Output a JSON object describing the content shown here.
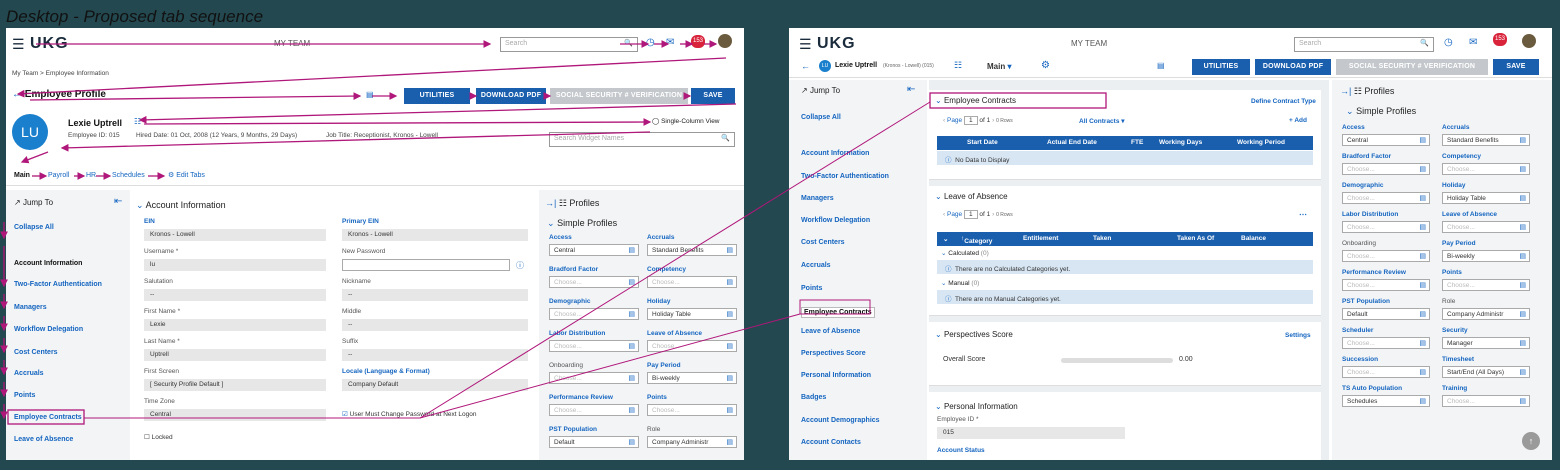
{
  "slide_title": "Desktop - Proposed tab sequence",
  "app": {
    "logo": "UKG",
    "title": "MY TEAM",
    "search_placeholder": "Search",
    "notification_count": "153"
  },
  "left": {
    "breadcrumb": "My Team > Employee Information",
    "page_title": "Employee Profile",
    "buttons": {
      "utilities": "UTILITIES",
      "download_pdf": "DOWNLOAD PDF",
      "ssn": "SOCIAL SECURITY # VERIFICATION",
      "save": "SAVE"
    },
    "employee": {
      "initials": "LU",
      "name": "Lexie Uptrell",
      "id_line": "Employee ID: 015",
      "hired": "Hired Date: 01 Oct, 2008 (12 Years, 9 Months, 29 Days)",
      "job": "Job Title: Receptionist, Kronos - Lowell"
    },
    "single_column": "Single-Column View",
    "widget_search": "Search Widget Names",
    "tabs": [
      "Main",
      "Payroll",
      "HR",
      "Schedules",
      "Edit Tabs"
    ],
    "jump_to": "Jump To",
    "sidebar": [
      "Collapse All",
      "Account Information",
      "Two-Factor Authentication",
      "Managers",
      "Workflow Delegation",
      "Cost Centers",
      "Accruals",
      "Points",
      "Employee Contracts",
      "Leave of Absence"
    ],
    "account": {
      "title": "Account Information",
      "fields": [
        {
          "label": "EIN",
          "value": "Kronos - Lowell",
          "label2": "Primary EIN",
          "value2": "Kronos - Lowell"
        },
        {
          "label": "Username *",
          "value": "lu",
          "label2": "New Password",
          "value2": ""
        },
        {
          "label": "Salutation",
          "value": "--",
          "label2": "Nickname",
          "value2": "--"
        },
        {
          "label": "First Name *",
          "value": "Lexie",
          "label2": "Middle",
          "value2": "--"
        },
        {
          "label": "Last Name *",
          "value": "Uptrell",
          "label2": "Suffix",
          "value2": "--"
        },
        {
          "label": "First Screen",
          "value": "[ Security Profile Default ]",
          "label2": "Locale (Language & Format)",
          "value2": "Company Default"
        },
        {
          "label": "Time Zone",
          "value": "Central",
          "label2": "",
          "value2": ""
        }
      ],
      "must_change": "User Must Change Password at Next Logon",
      "locked": "Locked"
    },
    "profiles_title": "Profiles",
    "simple_profiles": "Simple Profiles",
    "profiles": [
      {
        "label": "Access",
        "value": "Central",
        "label2": "Accruals",
        "value2": "Standard Benefits"
      },
      {
        "label": "Bradford Factor",
        "value": "Choose...",
        "label2": "Competency",
        "value2": "Choose..."
      },
      {
        "label": "Demographic",
        "value": "Choose...",
        "label2": "Holiday",
        "value2": "Holiday Table"
      },
      {
        "label": "Labor Distribution",
        "value": "Choose...",
        "label2": "Leave of Absence",
        "value2": "Choose..."
      },
      {
        "label": "Onboarding",
        "value": "Choose...",
        "label2": "Pay Period",
        "value2": "Bi-weekly"
      },
      {
        "label": "Performance Review",
        "value": "Choose...",
        "label2": "Points",
        "value2": "Choose..."
      },
      {
        "label": "PST Population",
        "value": "Default",
        "label2": "Role",
        "value2": "Company Administr"
      }
    ]
  },
  "right": {
    "employee_chip": "Lexie Uptrell",
    "employee_chip_sub": "(Kronos - Lowell) (015)",
    "chip_initials": "LU",
    "tab_main": "Main",
    "buttons": {
      "utilities": "UTILITIES",
      "download_pdf": "DOWNLOAD PDF",
      "ssn": "SOCIAL SECURITY # VERIFICATION",
      "save": "SAVE"
    },
    "jump_to": "Jump To",
    "sidebar": [
      "Collapse All",
      "Account Information",
      "Two-Factor Authentication",
      "Managers",
      "Workflow Delegation",
      "Cost Centers",
      "Accruals",
      "Points",
      "Employee Contracts",
      "Leave of Absence",
      "Perspectives Score",
      "Personal Information",
      "Badges",
      "Account Demographics",
      "Account Contacts",
      "Pay Information"
    ],
    "contracts": {
      "title": "Employee Contracts",
      "define": "Define Contract Type",
      "page": "Page",
      "page_num": "1",
      "of": "of 1",
      "rows": "0 Rows",
      "all": "All Contracts",
      "add": "+ Add",
      "cols": [
        "Start Date",
        "Actual End Date",
        "FTE",
        "Working Days",
        "Working Period"
      ],
      "empty": "No Data to Display"
    },
    "loa": {
      "title": "Leave of Absence",
      "page": "Page",
      "page_num": "1",
      "of": "of 1",
      "rows": "0 Rows",
      "cols": [
        "Category",
        "Entitlement",
        "Taken",
        "Taken As Of",
        "Balance"
      ],
      "calc": "Calculated",
      "calc_count": "(0)",
      "calc_note": "There are no Calculated Categories yet.",
      "manual": "Manual",
      "manual_count": "(0)",
      "manual_note": "There are no Manual Categories yet."
    },
    "perspectives": {
      "title": "Perspectives Score",
      "settings": "Settings",
      "overall": "Overall Score",
      "score": "0.00"
    },
    "personal": {
      "title": "Personal Information",
      "emp_id_label": "Employee ID *",
      "emp_id": "015",
      "status": "Account Status"
    },
    "profiles_title": "Profiles",
    "simple_profiles": "Simple Profiles",
    "profiles": [
      {
        "label": "Access",
        "value": "Central",
        "label2": "Accruals",
        "value2": "Standard Benefits"
      },
      {
        "label": "Bradford Factor",
        "value": "Choose...",
        "label2": "Competency",
        "value2": "Choose..."
      },
      {
        "label": "Demographic",
        "value": "Choose...",
        "label2": "Holiday",
        "value2": "Holiday Table"
      },
      {
        "label": "Labor Distribution",
        "value": "Choose...",
        "label2": "Leave of Absence",
        "value2": "Choose..."
      },
      {
        "label": "Onboarding",
        "value": "Choose...",
        "label2": "Pay Period",
        "value2": "Bi-weekly"
      },
      {
        "label": "Performance Review",
        "value": "Choose...",
        "label2": "Points",
        "value2": "Choose..."
      },
      {
        "label": "PST Population",
        "value": "Default",
        "label2": "Role",
        "value2": "Company Administr"
      },
      {
        "label": "Scheduler",
        "value": "Choose...",
        "label2": "Security",
        "value2": "Manager"
      },
      {
        "label": "Succession",
        "value": "Choose...",
        "label2": "Timesheet",
        "value2": "Start/End (All Days)"
      },
      {
        "label": "TS Auto Population",
        "value": "Schedules",
        "label2": "Training",
        "value2": "Choose..."
      }
    ]
  },
  "colors": {
    "accent": "#1a5fae",
    "arrow": "#b0177a",
    "link": "#1565c0",
    "background": "#23484f"
  }
}
